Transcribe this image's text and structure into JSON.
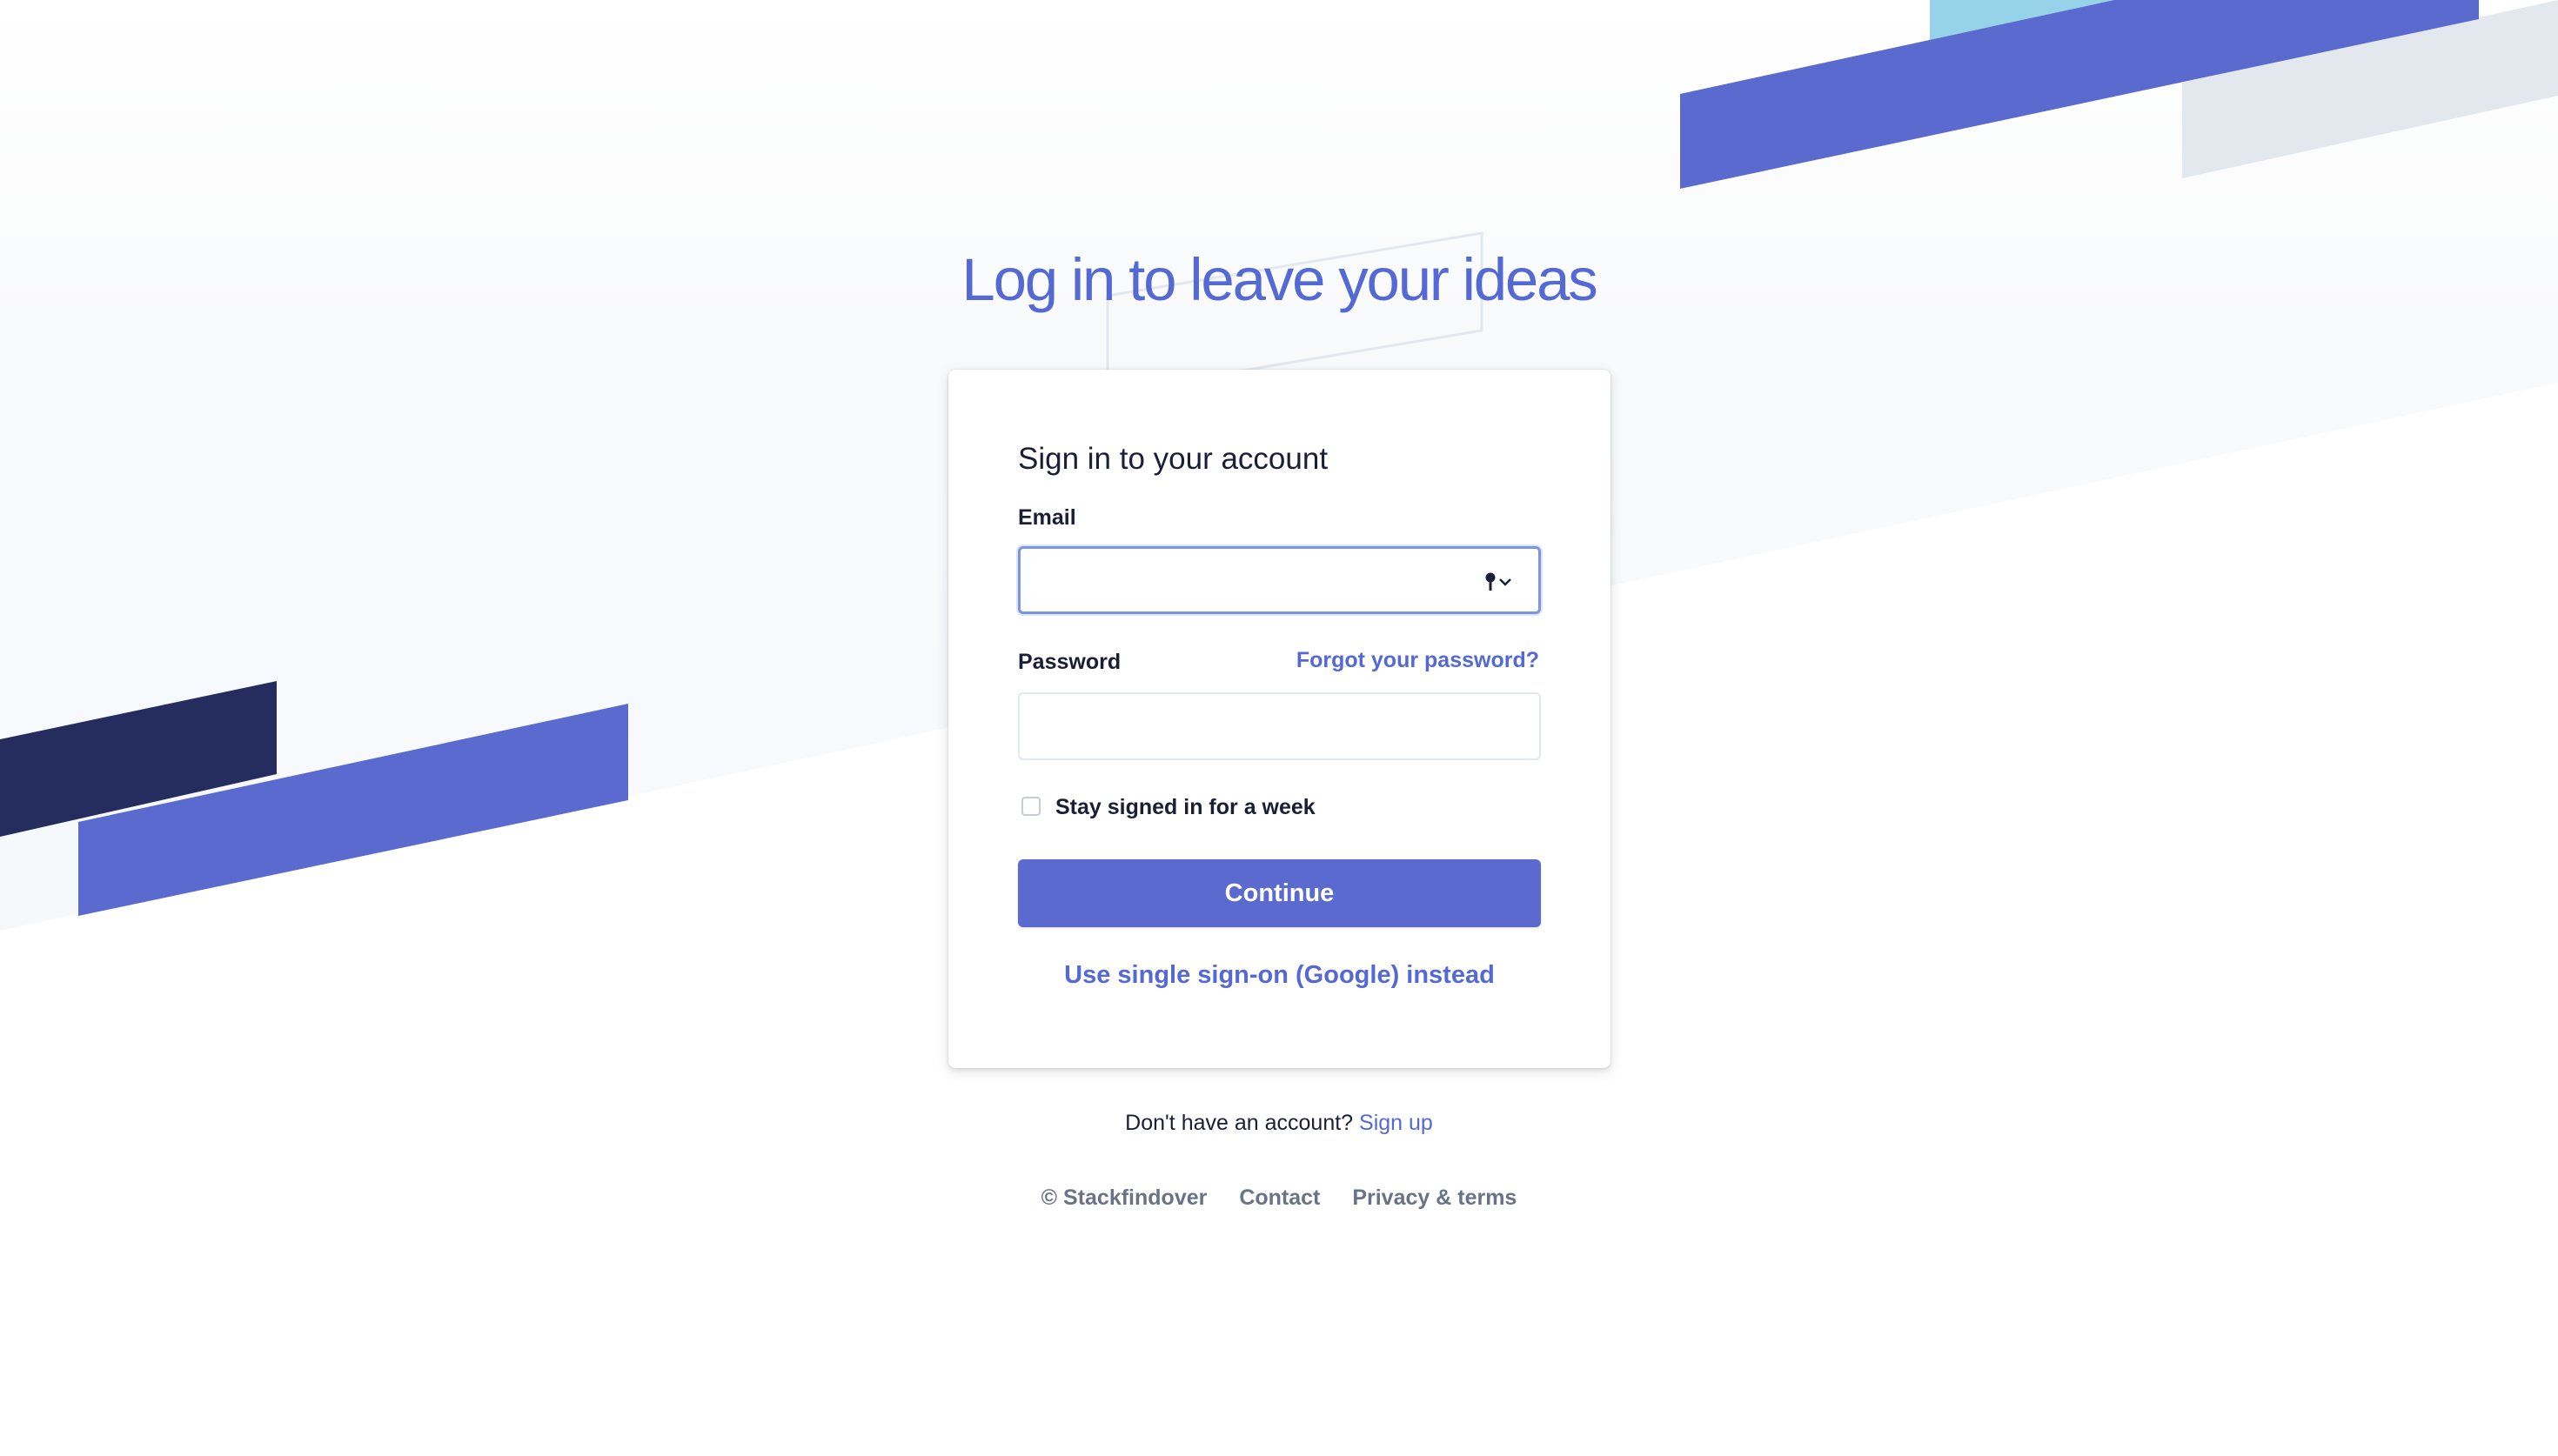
{
  "page": {
    "headline": "Log in to leave your ideas"
  },
  "card": {
    "title": "Sign in to your account",
    "email_label": "Email",
    "email_value": "",
    "password_label": "Password",
    "password_value": "",
    "forgot_link": "Forgot your password?",
    "remember_label": "Stay signed in for a week",
    "remember_checked": false,
    "continue_label": "Continue",
    "sso_link": "Use single sign-on (Google) instead"
  },
  "signup": {
    "prompt": "Don't have an account?",
    "link": "Sign up"
  },
  "footer": {
    "copyright": "© Stackfindover",
    "contact": "Contact",
    "privacy": "Privacy & terms"
  },
  "icons": {
    "autofill": "key-autofill-icon"
  },
  "colors": {
    "accent": "#5469d4",
    "button": "#5a6acf",
    "stripe_navy": "#252d5f",
    "stripe_light_blue": "#96d3e9",
    "stripe_gray": "#e3e8ee",
    "text_dark": "#1a1f36",
    "text_muted": "#697386"
  }
}
